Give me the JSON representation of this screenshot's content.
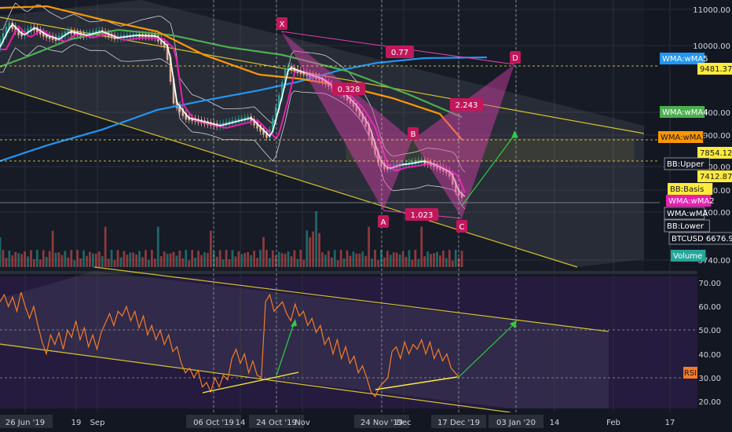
{
  "chart_data": [
    {
      "type": "candlestick",
      "title": "",
      "symbol": "BTCUSD",
      "y_ticks": [
        "11000.00",
        "10000.00",
        "8400.00",
        "7900.00",
        "7300.00",
        "6900.00",
        "6500.00",
        "5740.00"
      ],
      "ylim": [
        5740,
        11000
      ],
      "x_ticks": [
        "26 Jun '19",
        "19",
        "Sep",
        "06 Oct '19",
        "14",
        "24 Oct '19",
        "Nov",
        "24 Nov '19",
        "Dec",
        "17 Dec '19",
        "03 Jan '20",
        "14",
        "Feb",
        "17"
      ],
      "price_tags": [
        {
          "label": "WMA:wMA5",
          "value": "",
          "color": "#2196f3"
        },
        {
          "label": "",
          "value": "9481.37",
          "color": "#ffeb3b"
        },
        {
          "label": "WMA:wMA4",
          "value": "",
          "color": "#4caf50"
        },
        {
          "label": "WMA:wMA3",
          "value": "",
          "color": "#ff9800"
        },
        {
          "label": "",
          "value": "7854.12",
          "color": "#ffeb3b"
        },
        {
          "label": "BB:Upper",
          "value": "",
          "color": "#ffffff"
        },
        {
          "label": "",
          "value": "7412.87",
          "color": "#ffeb3b"
        },
        {
          "label": "BB:Basis",
          "value": "",
          "color": "#ffeb3b"
        },
        {
          "label": "WMA:wMA2",
          "value": "",
          "color": "#e91eb0"
        },
        {
          "label": "WMA:wMA",
          "value": "",
          "color": "#ffffff"
        },
        {
          "label": "BB:Lower",
          "value": "",
          "color": "#ffffff"
        },
        {
          "label": "BTCUSD",
          "value": "6676.92",
          "color": "#ffffff"
        },
        {
          "label": "Volume",
          "value": "",
          "color": "#26a69a"
        }
      ],
      "pattern_points": [
        {
          "label": "X",
          "x": "24 Oct '19",
          "y": 10400
        },
        {
          "label": "A",
          "x": "24 Nov '19",
          "y": 6550
        },
        {
          "label": "B",
          "x": "Dec",
          "y": 7750
        },
        {
          "label": "C",
          "x": "17 Dec '19",
          "y": 6500
        },
        {
          "label": "D",
          "x": "03 Jan '20",
          "y": 9481.37
        }
      ],
      "ratios": [
        "0.77",
        "0.328",
        "2.243",
        "1.023"
      ],
      "series": [
        {
          "name": "BTCUSD",
          "color": "#ffffff"
        },
        {
          "name": "WMA:wMA2",
          "color": "#e91eb0"
        },
        {
          "name": "WMA:wMA3",
          "color": "#ff9800"
        },
        {
          "name": "WMA:wMA4",
          "color": "#4caf50"
        },
        {
          "name": "WMA:wMA5",
          "color": "#2196f3"
        }
      ]
    },
    {
      "type": "line",
      "name": "RSI",
      "y_ticks": [
        "70.00",
        "60.00",
        "50.00",
        "40.00",
        "30.00",
        "20.00"
      ],
      "ylim": [
        15,
        75
      ],
      "tag_label": "RSI",
      "values": [
        62,
        65,
        60,
        64,
        58,
        66,
        60,
        55,
        60,
        52,
        45,
        40,
        48,
        44,
        49,
        42,
        50,
        47,
        54,
        46,
        51,
        43,
        48,
        42,
        49,
        53,
        57,
        52,
        58,
        56,
        60,
        54,
        58,
        51,
        56,
        48,
        52,
        46,
        50,
        44,
        48,
        41,
        43,
        36,
        32,
        34,
        30,
        33,
        26,
        28,
        24,
        30,
        26,
        31,
        29,
        38,
        42,
        36,
        40,
        32,
        37,
        31,
        30,
        62,
        65,
        58,
        60,
        62,
        57,
        54,
        61,
        56,
        58,
        52,
        55,
        49,
        52,
        44,
        47,
        40,
        46,
        38,
        43,
        36,
        39,
        32,
        35,
        30,
        24,
        22,
        26,
        28,
        30,
        41,
        43,
        38,
        45,
        40,
        44,
        42,
        46,
        40,
        45,
        38,
        42,
        37,
        40,
        34,
        32,
        30
      ]
    }
  ]
}
